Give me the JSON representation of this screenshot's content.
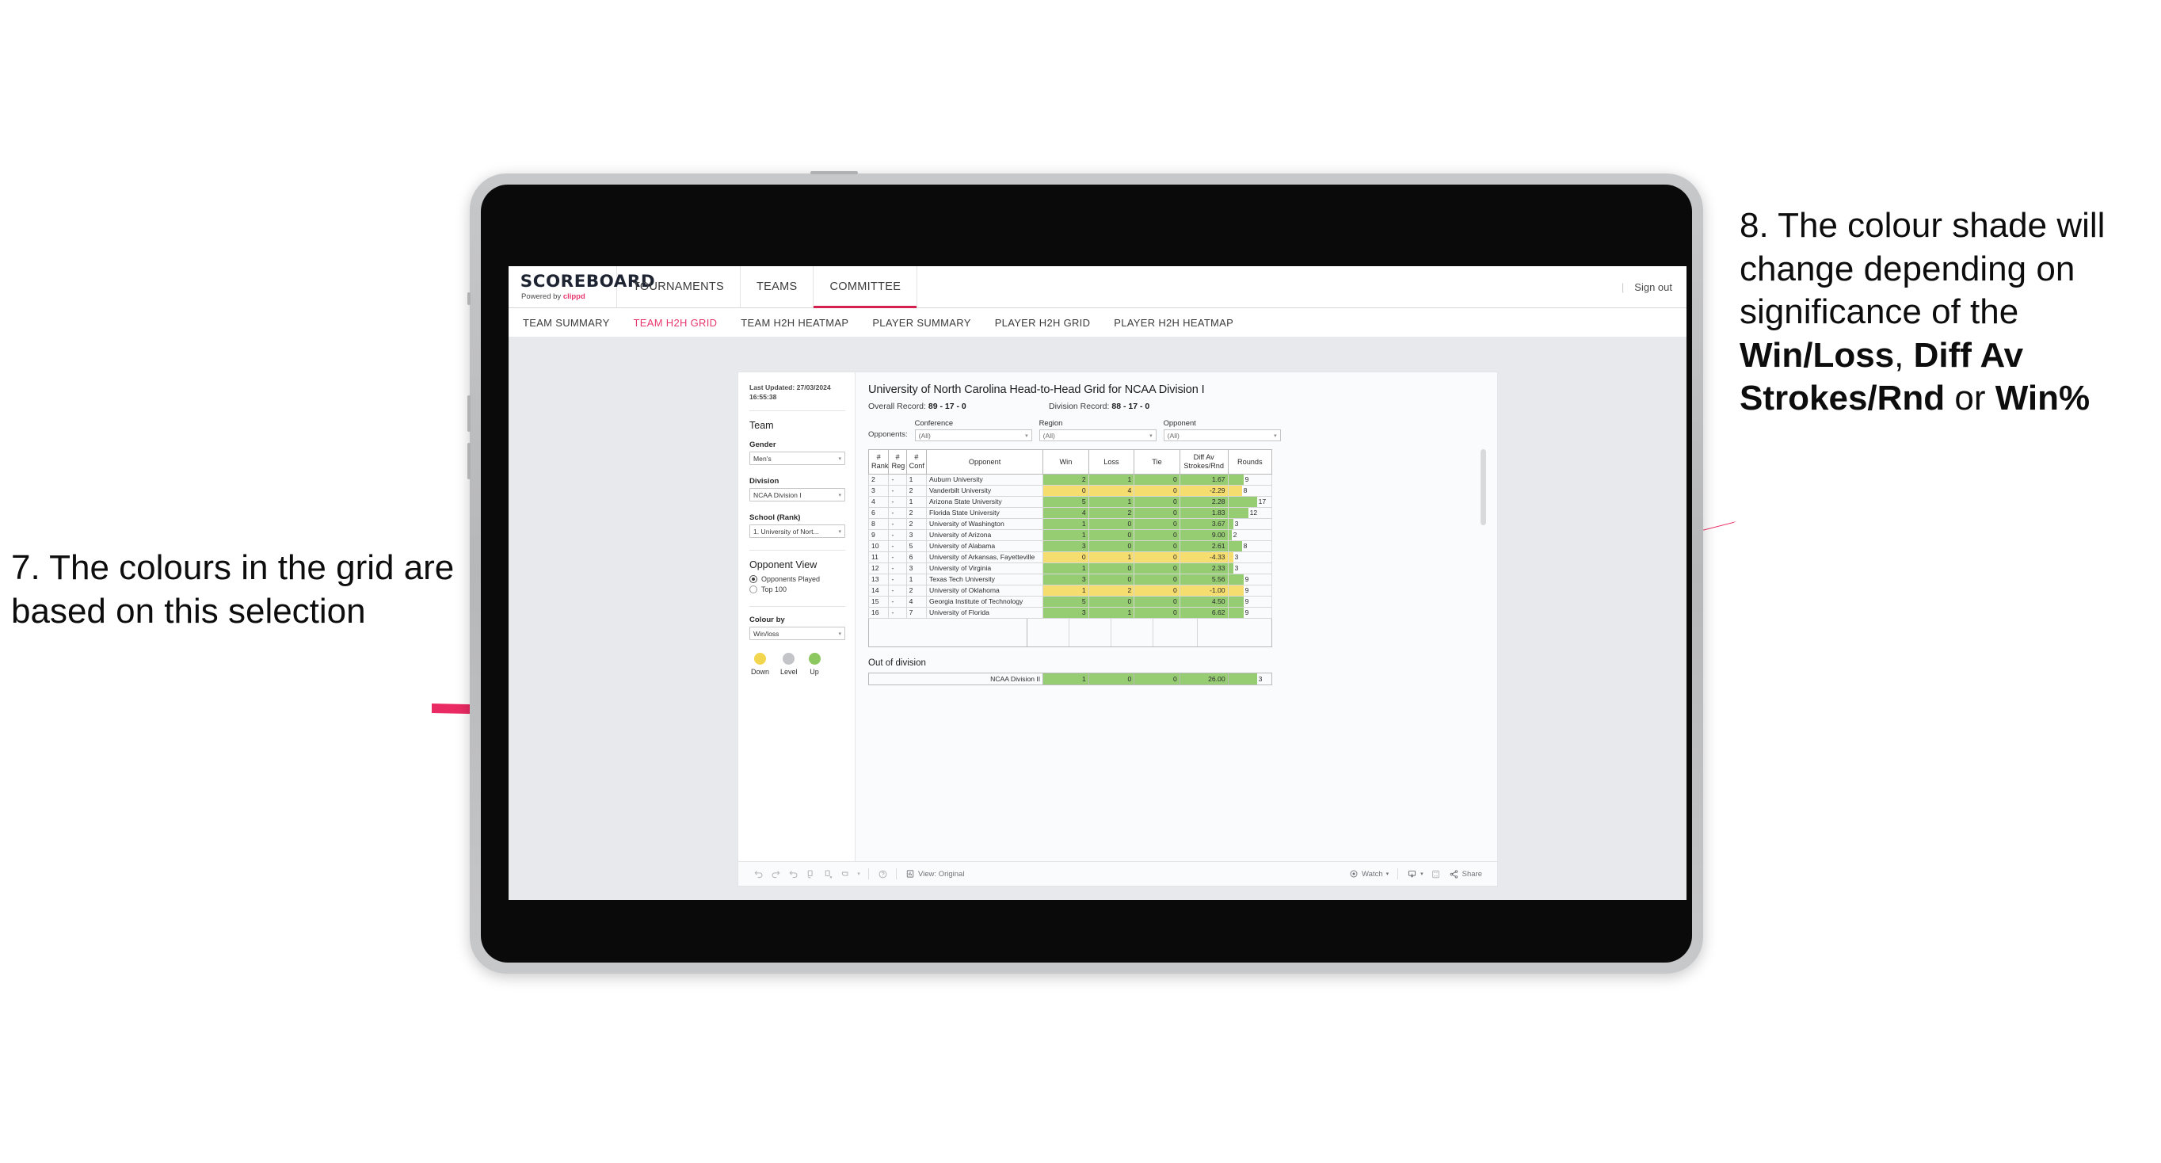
{
  "annotations": {
    "left": "7. The colours in the grid are based on this selection",
    "right_pre": "8. The colour shade will change depending on significance of the ",
    "right_b1": "Win/Loss",
    "right_mid1": ", ",
    "right_b2": "Diff Av Strokes/Rnd",
    "right_mid2": " or ",
    "right_b3": "Win%",
    "accent_color": "#e8376f"
  },
  "app": {
    "brand": {
      "name": "SCOREBOARD",
      "powered_prefix": "Powered by ",
      "powered_by": "clippd"
    },
    "topnav": [
      {
        "label": "TOURNAMENTS",
        "active": false
      },
      {
        "label": "TEAMS",
        "active": false
      },
      {
        "label": "COMMITTEE",
        "active": true
      }
    ],
    "signout": {
      "divider": "|",
      "label": "Sign out"
    },
    "subnav": [
      {
        "label": "TEAM SUMMARY",
        "active": false
      },
      {
        "label": "TEAM H2H GRID",
        "active": true
      },
      {
        "label": "TEAM H2H HEATMAP",
        "active": false
      },
      {
        "label": "PLAYER SUMMARY",
        "active": false
      },
      {
        "label": "PLAYER H2H GRID",
        "active": false
      },
      {
        "label": "PLAYER H2H HEATMAP",
        "active": false
      }
    ]
  },
  "filters": {
    "last_updated": "Last Updated: 27/03/2024 16:55:38",
    "team_heading": "Team",
    "gender": {
      "label": "Gender",
      "value": "Men's"
    },
    "division": {
      "label": "Division",
      "value": "NCAA Division I"
    },
    "school": {
      "label": "School (Rank)",
      "value": "1. University of Nort..."
    },
    "opponent_view": {
      "heading": "Opponent View",
      "options": [
        {
          "label": "Opponents Played",
          "selected": true
        },
        {
          "label": "Top 100",
          "selected": false
        }
      ]
    },
    "colour_by": {
      "label": "Colour by",
      "value": "Win/loss"
    },
    "legend": [
      {
        "label": "Down",
        "color": "#f2d64f"
      },
      {
        "label": "Level",
        "color": "#c2c4c7"
      },
      {
        "label": "Up",
        "color": "#8cc85f"
      }
    ]
  },
  "viz": {
    "title": "University of North Carolina Head-to-Head Grid for NCAA Division I",
    "overall_record_label": "Overall Record: ",
    "overall_record_value": "89 - 17 - 0",
    "division_record_label": "Division Record: ",
    "division_record_value": "88 - 17 - 0",
    "opponents_label": "Opponents:",
    "opponent_filters": [
      {
        "title": "Conference",
        "value": "(All)"
      },
      {
        "title": "Region",
        "value": "(All)"
      },
      {
        "title": "Opponent",
        "value": "(All)"
      }
    ]
  },
  "chart_data": {
    "type": "table",
    "title": "University of North Carolina Head-to-Head Grid for NCAA Division I",
    "columns": [
      "# Rank",
      "# Reg",
      "# Conf",
      "Opponent",
      "Win",
      "Loss",
      "Tie",
      "Diff Av Strokes/Rnd",
      "Rounds"
    ],
    "colour_scale": {
      "up": "#96cd73",
      "down": "#f5dd6f",
      "level": "#c2c4c7"
    },
    "rounds_max": 17,
    "rows": [
      {
        "rank": "2",
        "reg": "-",
        "conf": "1",
        "opponent": "Auburn University",
        "win": "2",
        "loss": "1",
        "tie": "0",
        "diff": "1.67",
        "rounds": "9",
        "state": "up"
      },
      {
        "rank": "3",
        "reg": "-",
        "conf": "2",
        "opponent": "Vanderbilt University",
        "win": "0",
        "loss": "4",
        "tie": "0",
        "diff": "-2.29",
        "rounds": "8",
        "state": "down"
      },
      {
        "rank": "4",
        "reg": "-",
        "conf": "1",
        "opponent": "Arizona State University",
        "win": "5",
        "loss": "1",
        "tie": "0",
        "diff": "2.28",
        "rounds": "17",
        "state": "up"
      },
      {
        "rank": "6",
        "reg": "-",
        "conf": "2",
        "opponent": "Florida State University",
        "win": "4",
        "loss": "2",
        "tie": "0",
        "diff": "1.83",
        "rounds": "12",
        "state": "up"
      },
      {
        "rank": "8",
        "reg": "-",
        "conf": "2",
        "opponent": "University of Washington",
        "win": "1",
        "loss": "0",
        "tie": "0",
        "diff": "3.67",
        "rounds": "3",
        "state": "up"
      },
      {
        "rank": "9",
        "reg": "-",
        "conf": "3",
        "opponent": "University of Arizona",
        "win": "1",
        "loss": "0",
        "tie": "0",
        "diff": "9.00",
        "rounds": "2",
        "state": "up"
      },
      {
        "rank": "10",
        "reg": "-",
        "conf": "5",
        "opponent": "University of Alabama",
        "win": "3",
        "loss": "0",
        "tie": "0",
        "diff": "2.61",
        "rounds": "8",
        "state": "up"
      },
      {
        "rank": "11",
        "reg": "-",
        "conf": "6",
        "opponent": "University of Arkansas, Fayetteville",
        "win": "0",
        "loss": "1",
        "tie": "0",
        "diff": "-4.33",
        "rounds": "3",
        "state": "down"
      },
      {
        "rank": "12",
        "reg": "-",
        "conf": "3",
        "opponent": "University of Virginia",
        "win": "1",
        "loss": "0",
        "tie": "0",
        "diff": "2.33",
        "rounds": "3",
        "state": "up"
      },
      {
        "rank": "13",
        "reg": "-",
        "conf": "1",
        "opponent": "Texas Tech University",
        "win": "3",
        "loss": "0",
        "tie": "0",
        "diff": "5.56",
        "rounds": "9",
        "state": "up"
      },
      {
        "rank": "14",
        "reg": "-",
        "conf": "2",
        "opponent": "University of Oklahoma",
        "win": "1",
        "loss": "2",
        "tie": "0",
        "diff": "-1.00",
        "rounds": "9",
        "state": "down"
      },
      {
        "rank": "15",
        "reg": "-",
        "conf": "4",
        "opponent": "Georgia Institute of Technology",
        "win": "5",
        "loss": "0",
        "tie": "0",
        "diff": "4.50",
        "rounds": "9",
        "state": "up"
      },
      {
        "rank": "16",
        "reg": "-",
        "conf": "7",
        "opponent": "University of Florida",
        "win": "3",
        "loss": "1",
        "tie": "0",
        "diff": "6.62",
        "rounds": "9",
        "state": "up"
      }
    ]
  },
  "out_of_division": {
    "heading": "Out of division",
    "row": {
      "label": "NCAA Division II",
      "win": "1",
      "loss": "0",
      "tie": "0",
      "diff": "26.00",
      "rounds": "3",
      "state": "up"
    }
  },
  "toolbar": {
    "view_label": "View: Original",
    "watch_label": "Watch",
    "share_label": "Share"
  }
}
